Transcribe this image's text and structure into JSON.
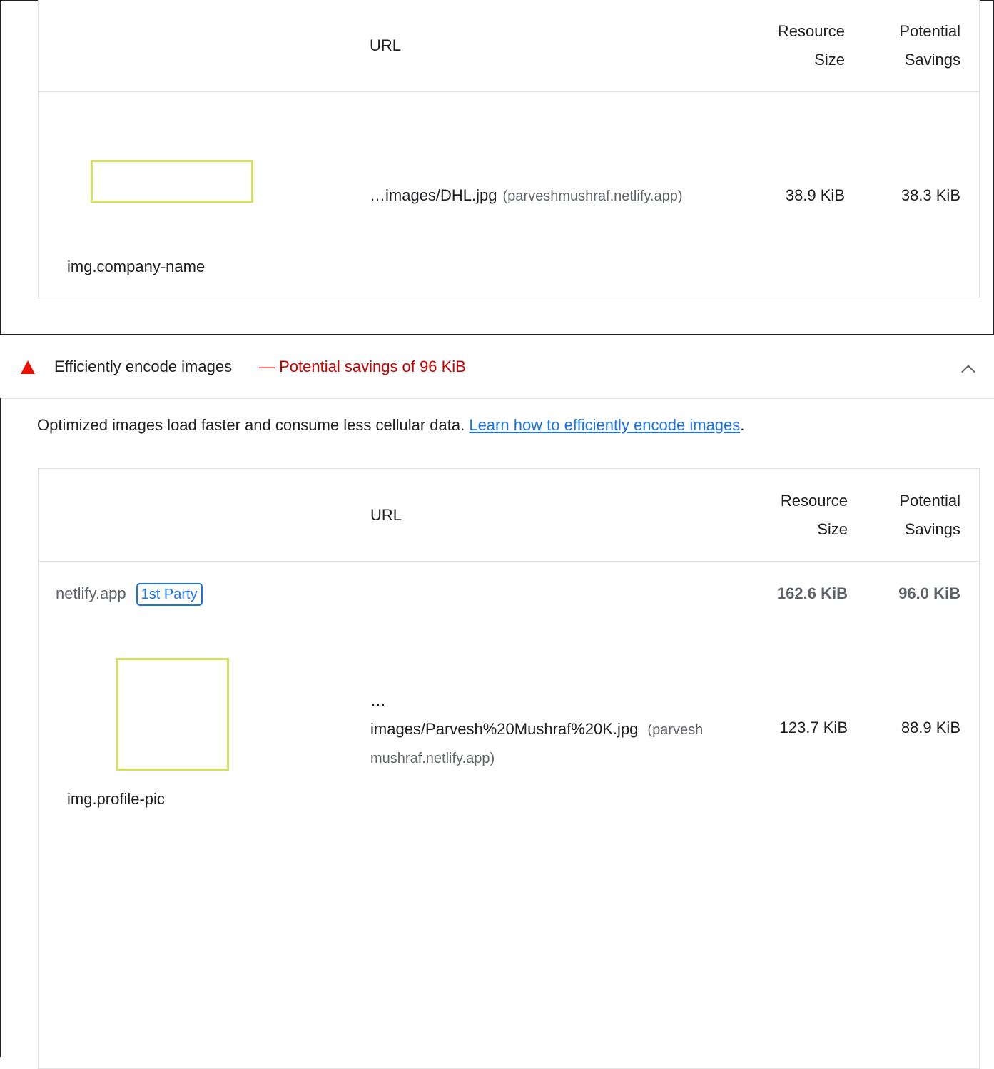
{
  "top_table": {
    "headers": {
      "url": "URL",
      "resource_size": [
        "Resource",
        "Size"
      ],
      "potential_savings": [
        "Potential",
        "Savings"
      ]
    },
    "row": {
      "node_label": "img.company-name",
      "url_path": "…images/DHL.jpg",
      "url_host": "(parveshmushraf.netlify.app)",
      "resource_size": "38.9 KiB",
      "potential_savings": "38.3 KiB"
    }
  },
  "audit": {
    "title": "Efficiently encode images",
    "savings_text": "— Potential savings of 96 KiB",
    "status_color": "#eb0f00",
    "description": "Optimized images load faster and consume less cellular data.",
    "learn_more_link": "Learn how to efficiently encode images",
    "learn_more_suffix": ".",
    "icons": {
      "status": "fail-triangle-icon",
      "toggle": "chevron-up-icon"
    }
  },
  "bottom_table": {
    "headers": {
      "url": "URL",
      "resource_size": [
        "Resource",
        "Size"
      ],
      "potential_savings": [
        "Potential",
        "Savings"
      ]
    },
    "group": {
      "entity": "netlify.app",
      "badge": "1st Party",
      "resource_size": "162.6 KiB",
      "potential_savings": "96.0 KiB"
    },
    "row": {
      "node_label": "img.profile-pic",
      "url_ellipsis": "…",
      "url_path": "images/Parvesh%20Mushraf%20K.jpg",
      "url_host_part1": "(parvesh",
      "url_host_part2": "mushraf.netlify.app)",
      "resource_size": "123.7 KiB",
      "potential_savings": "88.9 KiB"
    }
  },
  "colors": {
    "link": "#1a73e8",
    "fail": "#c00",
    "thumbnail_border": "#d5e062"
  }
}
